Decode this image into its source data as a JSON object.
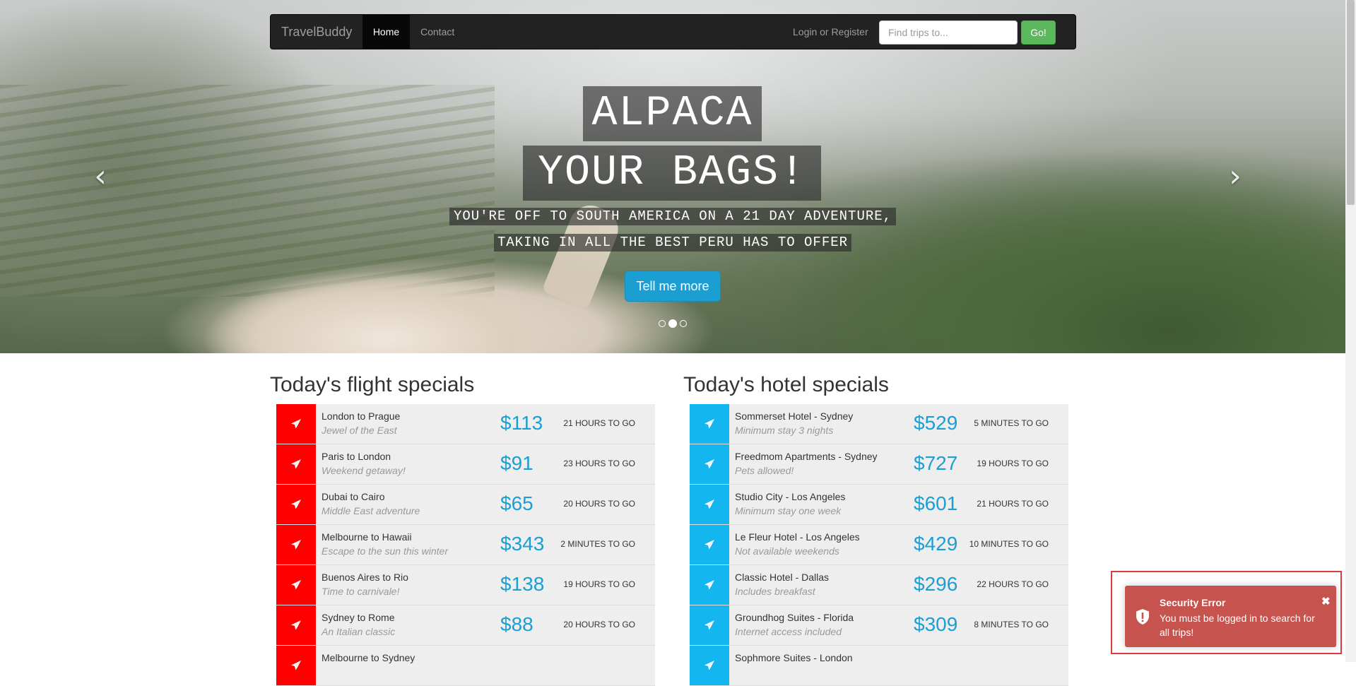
{
  "navbar": {
    "brand": "TravelBuddy",
    "home": "Home",
    "contact": "Contact",
    "login": "Login or Register",
    "search_placeholder": "Find trips to...",
    "go": "Go!"
  },
  "hero": {
    "headline_1": "ALPACA",
    "headline_2": "YOUR BAGS!",
    "sub_1": "YOU'RE OFF TO SOUTH AMERICA ON A 21 DAY ADVENTURE,",
    "sub_2": "TAKING IN ALL THE BEST PERU HAS TO OFFER",
    "button": "Tell me more",
    "active_slide_index": 1,
    "prev_icon": "chevron-left-icon",
    "next_icon": "chevron-right-icon"
  },
  "flights": {
    "title": "Today's flight specials",
    "icon": "paper-plane-icon",
    "icon_bg": "#ff0000",
    "items": [
      {
        "title": "London to Prague",
        "desc": "Jewel of the East",
        "price": "$113",
        "time": "21 HOURS TO GO"
      },
      {
        "title": "Paris to London",
        "desc": "Weekend getaway!",
        "price": "$91",
        "time": "23 HOURS TO GO"
      },
      {
        "title": "Dubai to Cairo",
        "desc": "Middle East adventure",
        "price": "$65",
        "time": "20 HOURS TO GO"
      },
      {
        "title": "Melbourne to Hawaii",
        "desc": "Escape to the sun this winter",
        "price": "$343",
        "time": "2 MINUTES TO GO"
      },
      {
        "title": "Buenos Aires to Rio",
        "desc": "Time to carnivale!",
        "price": "$138",
        "time": "19 HOURS TO GO"
      },
      {
        "title": "Sydney to Rome",
        "desc": "An Italian classic",
        "price": "$88",
        "time": "20 HOURS TO GO"
      },
      {
        "title": "Melbourne to Sydney",
        "desc": "",
        "price": "",
        "time": ""
      }
    ]
  },
  "hotels": {
    "title": "Today's hotel specials",
    "icon": "paper-plane-icon",
    "icon_bg": "#13b6ef",
    "items": [
      {
        "title": "Sommerset Hotel - Sydney",
        "desc": "Minimum stay 3 nights",
        "price": "$529",
        "time": "5 MINUTES TO GO"
      },
      {
        "title": "Freedmom Apartments - Sydney",
        "desc": "Pets allowed!",
        "price": "$727",
        "time": "19 HOURS TO GO"
      },
      {
        "title": "Studio City - Los Angeles",
        "desc": "Minimum stay one week",
        "price": "$601",
        "time": "21 HOURS TO GO"
      },
      {
        "title": "Le Fleur Hotel - Los Angeles",
        "desc": "Not available weekends",
        "price": "$429",
        "time": "10 MINUTES TO GO"
      },
      {
        "title": "Classic Hotel - Dallas",
        "desc": "Includes breakfast",
        "price": "$296",
        "time": "22 HOURS TO GO"
      },
      {
        "title": "Groundhog Suites - Florida",
        "desc": "Internet access included",
        "price": "$309",
        "time": "8 MINUTES TO GO"
      },
      {
        "title": "Sophmore Suites - London",
        "desc": "",
        "price": "",
        "time": ""
      }
    ]
  },
  "toast": {
    "title": "Security Error",
    "message": "You must be logged in to search for all trips!",
    "icon": "shield-alert-icon",
    "close": "✖",
    "bg_color": "#bd362f"
  },
  "colors": {
    "accent": "#1b9fd3",
    "navbar": "#222222",
    "go_button": "#5cb85c"
  }
}
